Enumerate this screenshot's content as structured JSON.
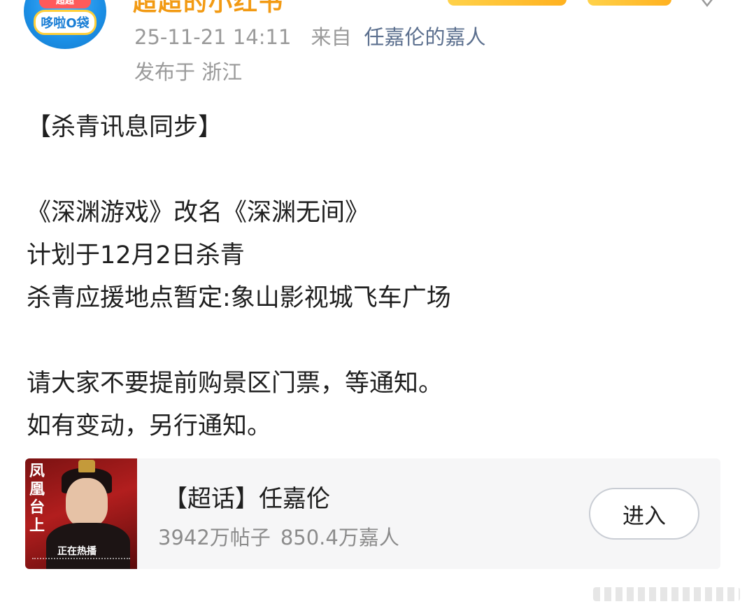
{
  "post": {
    "username_partial": "超超的小红书",
    "time": "25-11-21 14:11",
    "from_label": "来自",
    "source": "任嘉伦的嘉人",
    "location": "发布于 浙江",
    "lines": {
      "l1": "【杀青讯息同步】",
      "l2": "《深渊游戏》改名《深渊无间》",
      "l3": "计划于12月2日杀青",
      "l4": "杀青应援地点暂定:象山影视城飞车广场",
      "l5": "请大家不要提前购景区门票，等通知。",
      "l6": "如有变动，另行通知。"
    }
  },
  "avatar": {
    "top_text": "超超",
    "main_text": "哆啦O袋"
  },
  "topic_card": {
    "cover_title": "凤凰台上",
    "cover_status": "正在热播",
    "title": "【超话】任嘉伦",
    "posts": "3942万帖子",
    "fans": "850.4万嘉人",
    "enter_label": "进入"
  },
  "colors": {
    "link": "#5b6f8e",
    "meta": "#9a9a9a",
    "card_bg": "#f6f6f7",
    "username": "#f29a13"
  },
  "icons": {
    "more": "star-outline-icon"
  }
}
